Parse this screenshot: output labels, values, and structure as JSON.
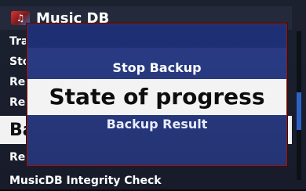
{
  "titlebar": {
    "title": "Music DB",
    "icon": "music-db-icon"
  },
  "menu": {
    "items": [
      {
        "label": "Tra"
      },
      {
        "label": "Sto"
      },
      {
        "label": "Re"
      },
      {
        "label": "Re"
      },
      {
        "label": "Ba"
      },
      {
        "label": "Re"
      },
      {
        "label": "MusicDB Integrity Check"
      }
    ]
  },
  "dialog": {
    "options": [
      {
        "label": "Stop Backup"
      },
      {
        "label": "State of progress"
      },
      {
        "label": "Backup Result"
      }
    ]
  },
  "colors": {
    "dialog_bg": "#2a3c86",
    "dialog_border": "#8a1b1b",
    "selected_bg": "#f3f3f3",
    "scroll_thumb": "#2b62c8"
  }
}
